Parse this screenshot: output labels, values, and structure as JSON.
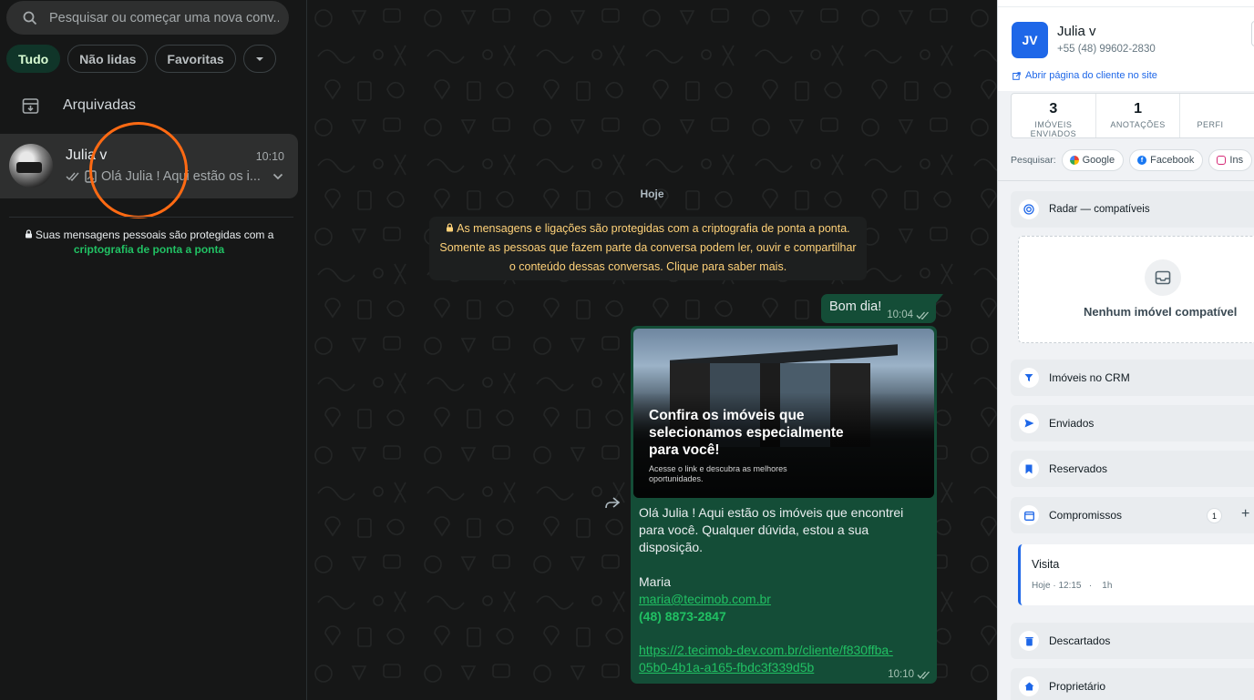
{
  "sidebar": {
    "search_placeholder": "Pesquisar ou começar uma nova conv...",
    "filters": [
      "Tudo",
      "Não lidas",
      "Favoritas"
    ],
    "archived_label": "Arquivadas",
    "chat": {
      "name": "Julia v",
      "time": "10:10",
      "preview": "Olá Julia ! Aqui estão os i..."
    },
    "e2e_note": "Suas mensagens pessoais são protegidas com a",
    "e2e_link": "criptografia de ponta a ponta"
  },
  "conversation": {
    "day_label": "Hoje",
    "encryption_notice": [
      "As mensagens e ligações são protegidas com a criptografia de ponta a ponta.",
      "Somente as pessoas que fazem parte da conversa podem ler, ouvir e compartilhar",
      "o conteúdo dessas conversas. Clique para saber mais."
    ],
    "messages": [
      {
        "text": "Bom dia!",
        "time": "10:04"
      },
      {
        "image_title": "Confira os imóveis que selecionamos especialmente para você!",
        "image_subtitle": "Acesse o link e descubra as melhores oportunidades.",
        "lines": [
          "Olá Julia ! Aqui estão os imóveis que encontrei",
          "para você. Qualquer dúvida, estou a sua",
          "disposição."
        ],
        "signature": "Maria",
        "email": "maria@tecimob.com.br",
        "phone": "(48) 8873-2847",
        "url_lines": [
          "https://2.tecimob-dev.com.br/cliente/f830ffba-",
          "05b0-4b1a-a165-fbdc3f339d5b"
        ],
        "time": "10:10"
      }
    ]
  },
  "crm": {
    "initials": "JV",
    "client_name": "Julia v",
    "client_phone": "+55 (48) 99602-2830",
    "client_page_link": "Abrir página do cliente no site",
    "stats": [
      {
        "value": "3",
        "label": "IMÓVEIS ENVIADOS"
      },
      {
        "value": "1",
        "label": "ANOTAÇÕES"
      },
      {
        "value": "",
        "label": "PERFI"
      }
    ],
    "search_label": "Pesquisar:",
    "search_buttons": [
      "Google",
      "Facebook",
      "Ins"
    ],
    "sections": {
      "radar": "Radar — compatíveis",
      "radar_empty": "Nenhum imóvel compatível",
      "crm_properties": "Imóveis no CRM",
      "sent": "Enviados",
      "reserved": "Reservados",
      "appointments": "Compromissos",
      "appointments_count": "1",
      "discarded": "Descartados",
      "owner": "Proprietário"
    },
    "appointment": {
      "title": "Visita",
      "when": "Hoje · 12:15",
      "duration": "1h"
    }
  },
  "colors": {
    "accent_green": "#21c063",
    "outgoing_bubble": "#144d37",
    "crm_blue": "#1e67e8",
    "annotation_circle": "#ff6a13"
  }
}
